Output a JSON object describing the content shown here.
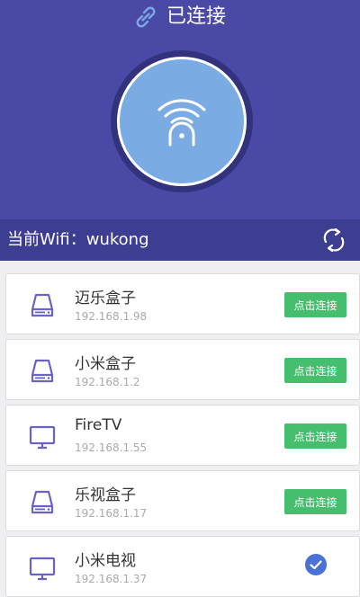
{
  "header": {
    "status_text": "已连接",
    "link_icon": "link-icon",
    "center_icon": "wifi-tv-icon"
  },
  "wifi_bar": {
    "label": "当前Wifi：wukong",
    "refresh_icon": "refresh-icon"
  },
  "colors": {
    "header_bg": "#4a4aa6",
    "wifi_bar_bg": "#3d3d91",
    "circle_fill": "#7babe3",
    "button_green": "#45bf6d",
    "check_blue": "#4a72d6",
    "device_icon": "#6a63c7"
  },
  "devices": [
    {
      "name": "迈乐盒子",
      "ip": "192.168.1.98",
      "icon": "box-icon",
      "action": "点击连接",
      "connected": false
    },
    {
      "name": "小米盒子",
      "ip": "192.168.1.2",
      "icon": "box-icon",
      "action": "点击连接",
      "connected": false
    },
    {
      "name": "FireTV",
      "ip": "192.168.1.55",
      "icon": "tv-icon",
      "action": "点击连接",
      "connected": false
    },
    {
      "name": "乐视盒子",
      "ip": "192.168.1.17",
      "icon": "box-icon",
      "action": "点击连接",
      "connected": false
    },
    {
      "name": "小米电视",
      "ip": "192.168.1.37",
      "icon": "tv-icon",
      "action": "",
      "connected": true
    }
  ]
}
